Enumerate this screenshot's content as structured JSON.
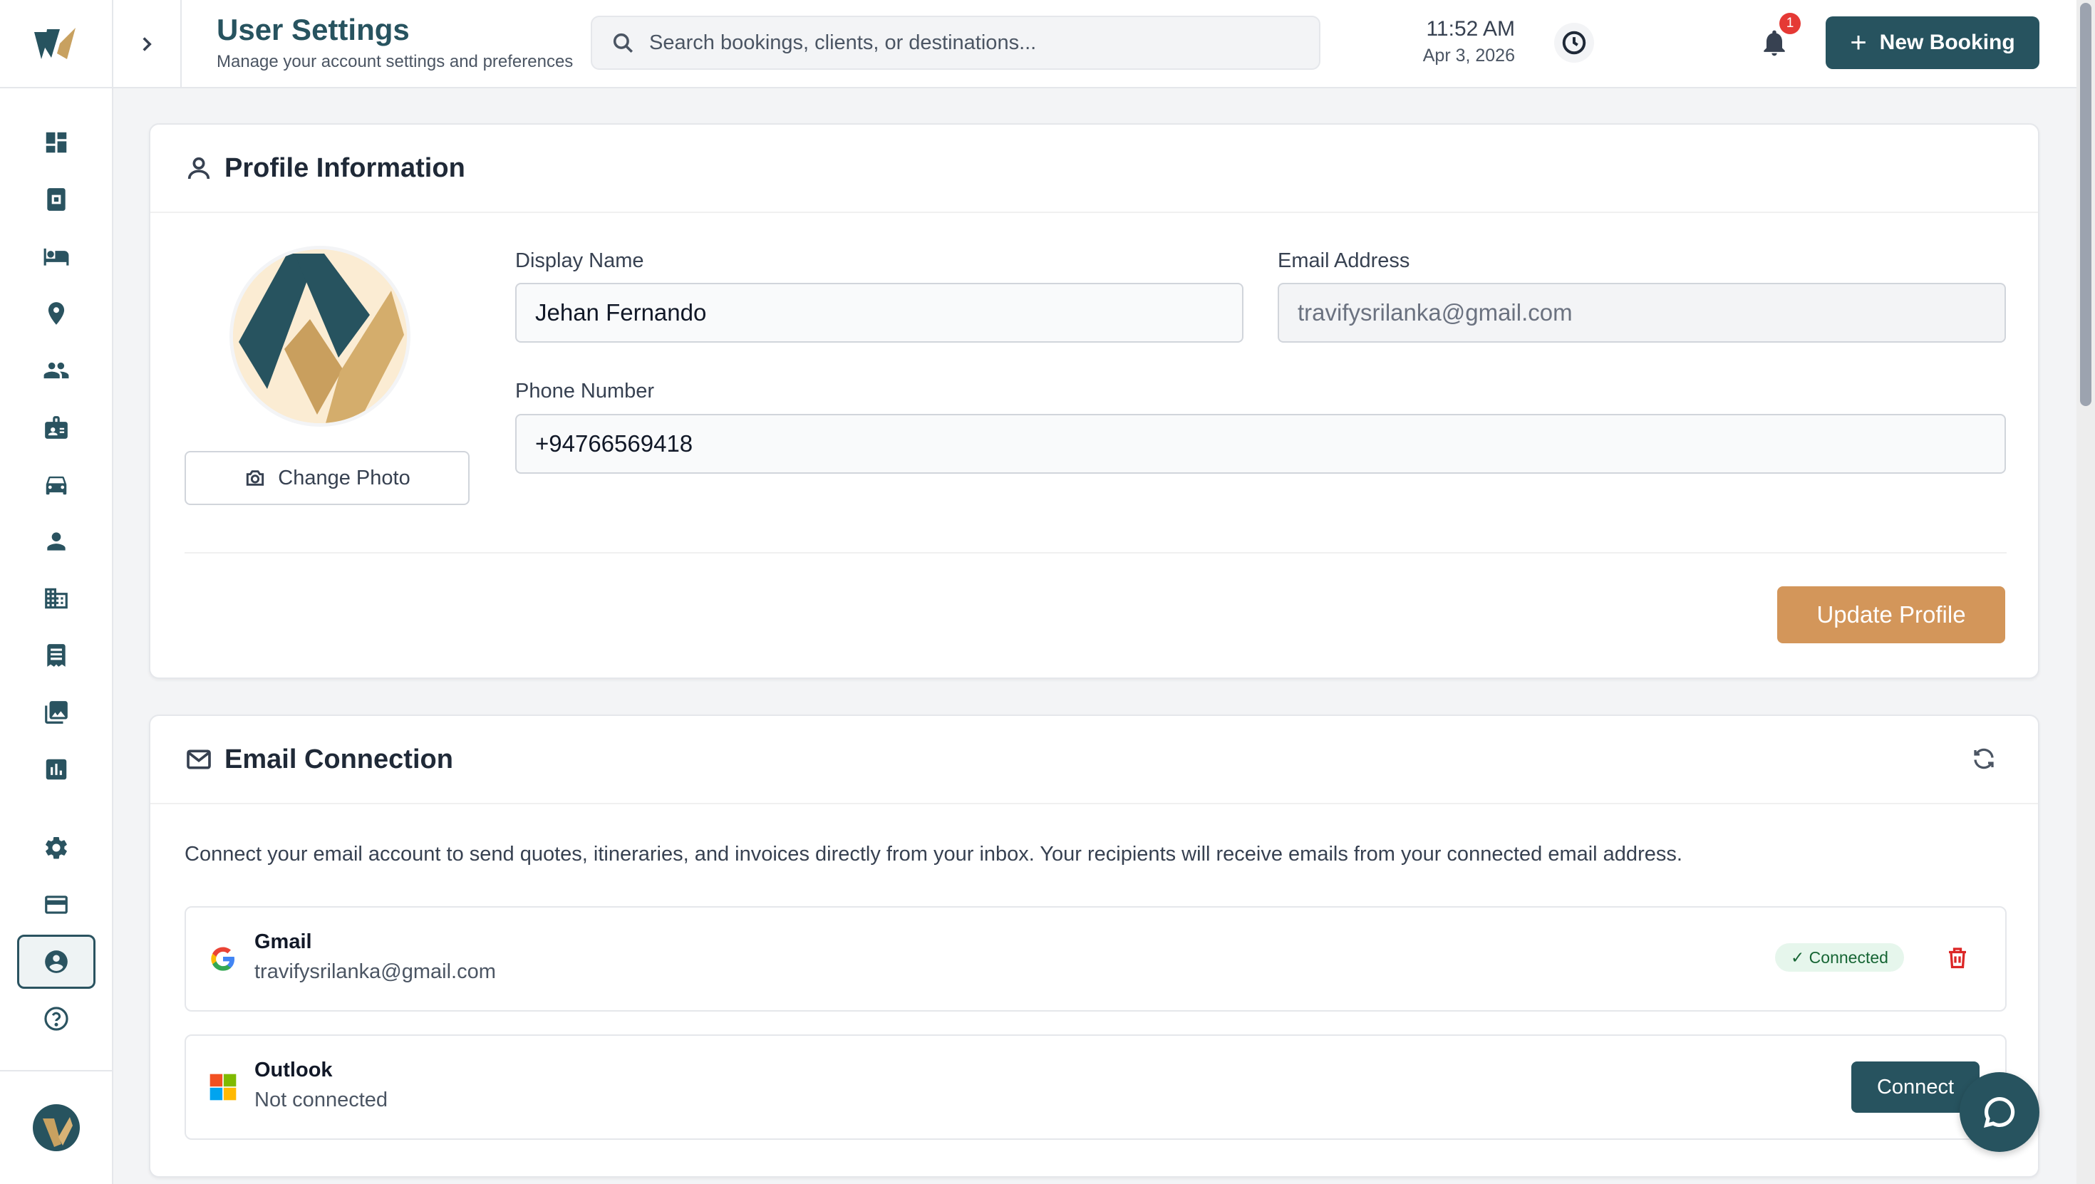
{
  "header": {
    "title": "User Settings",
    "subtitle": "Manage your account settings and preferences",
    "search_placeholder": "Search bookings, clients, or destinations...",
    "time": "11:52 AM",
    "date": "Apr 3, 2026",
    "notification_count": "1",
    "new_booking_label": "New Booking"
  },
  "sidebar": {
    "items": [
      {
        "icon": "dashboard-icon"
      },
      {
        "icon": "bookings-icon"
      },
      {
        "icon": "hotel-bed-icon"
      },
      {
        "icon": "location-pin-icon"
      },
      {
        "icon": "people-icon"
      },
      {
        "icon": "id-badge-icon"
      },
      {
        "icon": "car-icon"
      },
      {
        "icon": "person-icon"
      },
      {
        "icon": "building-icon"
      },
      {
        "icon": "receipt-icon"
      },
      {
        "icon": "photo-library-icon"
      },
      {
        "icon": "bar-chart-icon"
      }
    ],
    "bottom_items": [
      {
        "icon": "settings-gear-icon"
      },
      {
        "icon": "credit-card-icon"
      },
      {
        "icon": "account-circle-icon",
        "active": true
      },
      {
        "icon": "help-circle-icon"
      }
    ]
  },
  "profile": {
    "section_title": "Profile Information",
    "change_photo_label": "Change Photo",
    "display_name_label": "Display Name",
    "display_name_value": "Jehan Fernando",
    "email_label": "Email Address",
    "email_value": "travifysrilanka@gmail.com",
    "phone_label": "Phone Number",
    "phone_value": "+94766569418",
    "update_label": "Update Profile"
  },
  "email_connection": {
    "section_title": "Email Connection",
    "description": "Connect your email account to send quotes, itineraries, and invoices directly from your inbox. Your recipients will receive emails from your connected email address.",
    "providers": [
      {
        "name": "Gmail",
        "status": "travifysrilanka@gmail.com",
        "badge": "✓ Connected"
      },
      {
        "name": "Outlook",
        "status": "Not connected",
        "action": "Connect"
      }
    ]
  },
  "colors": {
    "brand_teal": "#27535f",
    "brand_gold": "#d3965a",
    "connected_green": "#166534",
    "danger_red": "#dc2626"
  }
}
